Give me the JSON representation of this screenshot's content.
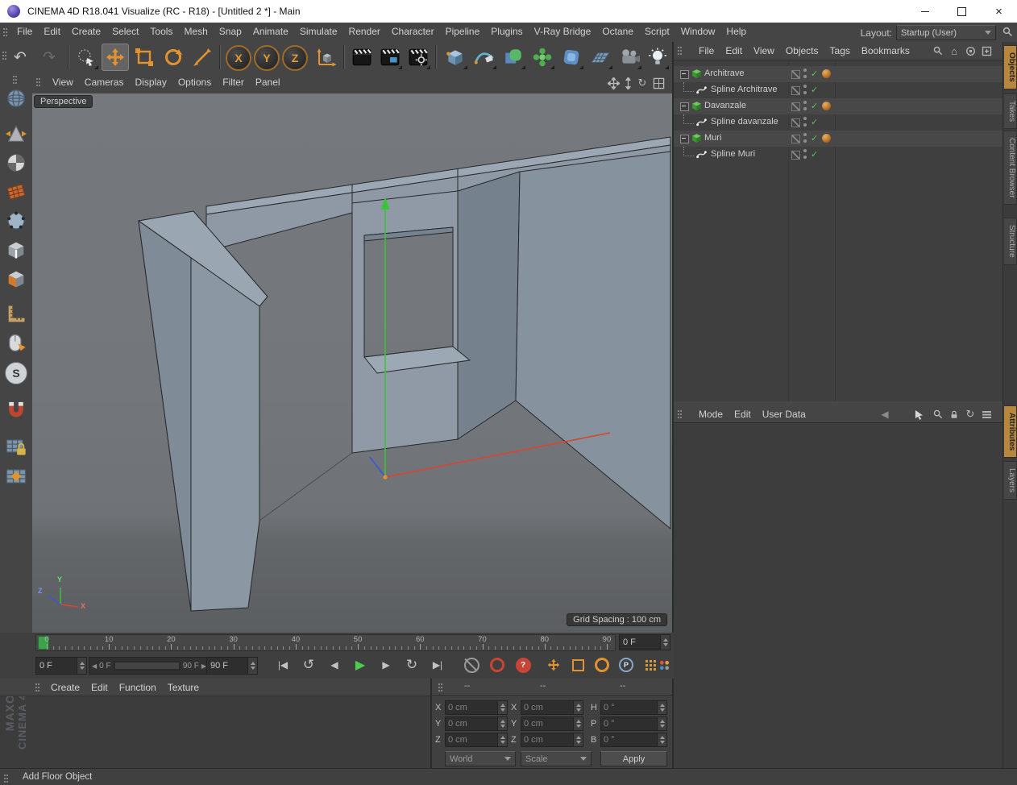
{
  "window": {
    "title": "CINEMA 4D R18.041 Visualize (RC - R18) - [Untitled 2 *] - Main"
  },
  "menubar": {
    "items": [
      "File",
      "Edit",
      "Create",
      "Select",
      "Tools",
      "Mesh",
      "Snap",
      "Animate",
      "Simulate",
      "Render",
      "Character",
      "Pipeline",
      "Plugins",
      "V-Ray Bridge",
      "Octane",
      "Script",
      "Window",
      "Help"
    ],
    "layout_label": "Layout:",
    "layout_value": "Startup (User)"
  },
  "toolbar": {
    "axis_locks": [
      "X",
      "Y",
      "Z"
    ]
  },
  "viewport": {
    "menu": [
      "View",
      "Cameras",
      "Display",
      "Options",
      "Filter",
      "Panel"
    ],
    "camera_label": "Perspective",
    "grid_spacing": "Grid Spacing : 100 cm",
    "axis": {
      "x": "X",
      "y": "Y",
      "z": "Z"
    }
  },
  "object_manager": {
    "menu": [
      "File",
      "Edit",
      "View",
      "Objects",
      "Tags",
      "Bookmarks"
    ],
    "tree": [
      {
        "name": "Architrave",
        "type": "generator",
        "depth": 0
      },
      {
        "name": "Spline Architrave",
        "type": "spline",
        "depth": 1
      },
      {
        "name": "Davanzale",
        "type": "generator",
        "depth": 0
      },
      {
        "name": "Spline davanzale",
        "type": "spline",
        "depth": 1
      },
      {
        "name": "Muri",
        "type": "generator",
        "depth": 0
      },
      {
        "name": "Spline Muri",
        "type": "spline",
        "depth": 1
      }
    ]
  },
  "attribute_manager": {
    "menu": [
      "Mode",
      "Edit",
      "User Data"
    ]
  },
  "side_tabs": {
    "top": [
      "Objects",
      "Takes",
      "Content Browser",
      "Structure"
    ],
    "bottom": [
      "Attributes",
      "Layers"
    ],
    "active": [
      "Objects",
      "Attributes"
    ]
  },
  "timeline": {
    "ticks": [
      "0",
      "10",
      "20",
      "30",
      "40",
      "50",
      "60",
      "70",
      "80",
      "90"
    ],
    "current_frame": "0 F"
  },
  "transport": {
    "current": "0 F",
    "range_start": "0 F",
    "range_end": "90 F",
    "end_frame": "90 F"
  },
  "material_manager": {
    "menu": [
      "Create",
      "Edit",
      "Function",
      "Texture"
    ]
  },
  "coordinates": {
    "headers": [
      "--",
      "--",
      "--"
    ],
    "position": [
      {
        "label": "X",
        "value": "0 cm"
      },
      {
        "label": "Y",
        "value": "0 cm"
      },
      {
        "label": "Z",
        "value": "0 cm"
      }
    ],
    "size": [
      {
        "label": "X",
        "value": "0 cm"
      },
      {
        "label": "Y",
        "value": "0 cm"
      },
      {
        "label": "Z",
        "value": "0 cm"
      }
    ],
    "rotation": [
      {
        "label": "H",
        "value": "0 °"
      },
      {
        "label": "P",
        "value": "0 °"
      },
      {
        "label": "B",
        "value": "0 °"
      }
    ],
    "system": "World",
    "mode": "Scale",
    "apply": "Apply"
  },
  "status_bar": {
    "text": "Add Floor Object"
  },
  "watermark": {
    "line1": "MAXON",
    "line2": "CINEMA 4D"
  },
  "icons": {
    "undo": "↶",
    "redo": "↷",
    "goto_start": "|◀",
    "play_backward": "↺",
    "prev_frame": "◀",
    "play": "▶",
    "next_frame": "▶",
    "loop": "↻",
    "goto_end": "▶|",
    "home": "⌂",
    "rotate_view": "↻",
    "back": "◀",
    "sync": "↻",
    "close": "×",
    "parameter": "P",
    "snap": "S",
    "question": "?",
    "check": "✓"
  },
  "colors": {
    "accent": "#e2932f",
    "axis_x": "#d9452e",
    "axis_y": "#3cc33c",
    "axis_z": "#3a56d8",
    "check": "#5fc05f",
    "tab_active": "#b9863e"
  }
}
